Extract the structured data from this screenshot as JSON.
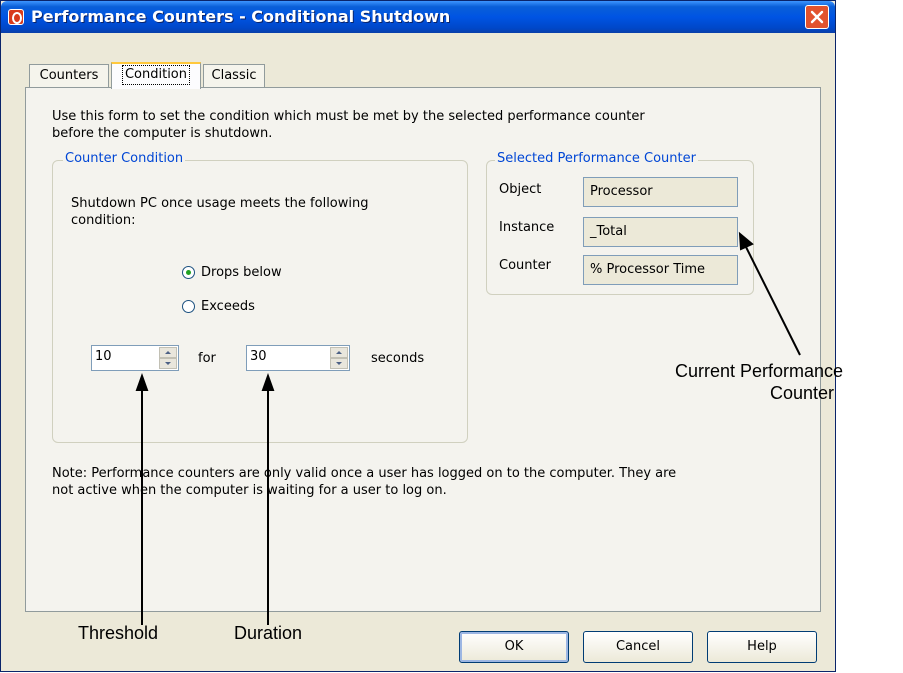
{
  "window": {
    "title": "Performance Counters - Conditional Shutdown"
  },
  "tabs": [
    {
      "label": "Counters"
    },
    {
      "label": "Condition"
    },
    {
      "label": "Classic"
    }
  ],
  "intro": {
    "line1": "Use this form to set the condition which must be met by the selected performance counter",
    "line2": "before the computer is shutdown."
  },
  "counter_condition": {
    "legend": "Counter Condition",
    "desc_line1": "Shutdown PC once usage meets the following",
    "desc_line2": "condition:",
    "options": [
      {
        "label": "Drops below",
        "selected": true
      },
      {
        "label": "Exceeds",
        "selected": false
      }
    ],
    "threshold_value": "10",
    "for_label": "for",
    "duration_value": "30",
    "seconds_label": "seconds"
  },
  "selected_counter": {
    "legend": "Selected Performance Counter",
    "object_label": "Object",
    "object_value": "Processor",
    "instance_label": "Instance",
    "instance_value": "_Total",
    "counter_label": "Counter",
    "counter_value": "% Processor Time"
  },
  "note": {
    "line1": "Note: Performance counters are only valid once a user has logged on to the computer. They are",
    "line2": "not active when the computer is waiting for a user to log on."
  },
  "buttons": {
    "ok": "OK",
    "cancel": "Cancel",
    "help": "Help"
  },
  "annotations": {
    "current_line1": "Current Performance",
    "current_line2": "Counter",
    "threshold": "Threshold",
    "duration": "Duration"
  },
  "colors": {
    "titlebar": "#0054e3",
    "dialog_bg": "#ece9d8",
    "legend_text": "#0046d5",
    "close_button": "#e2522e"
  }
}
